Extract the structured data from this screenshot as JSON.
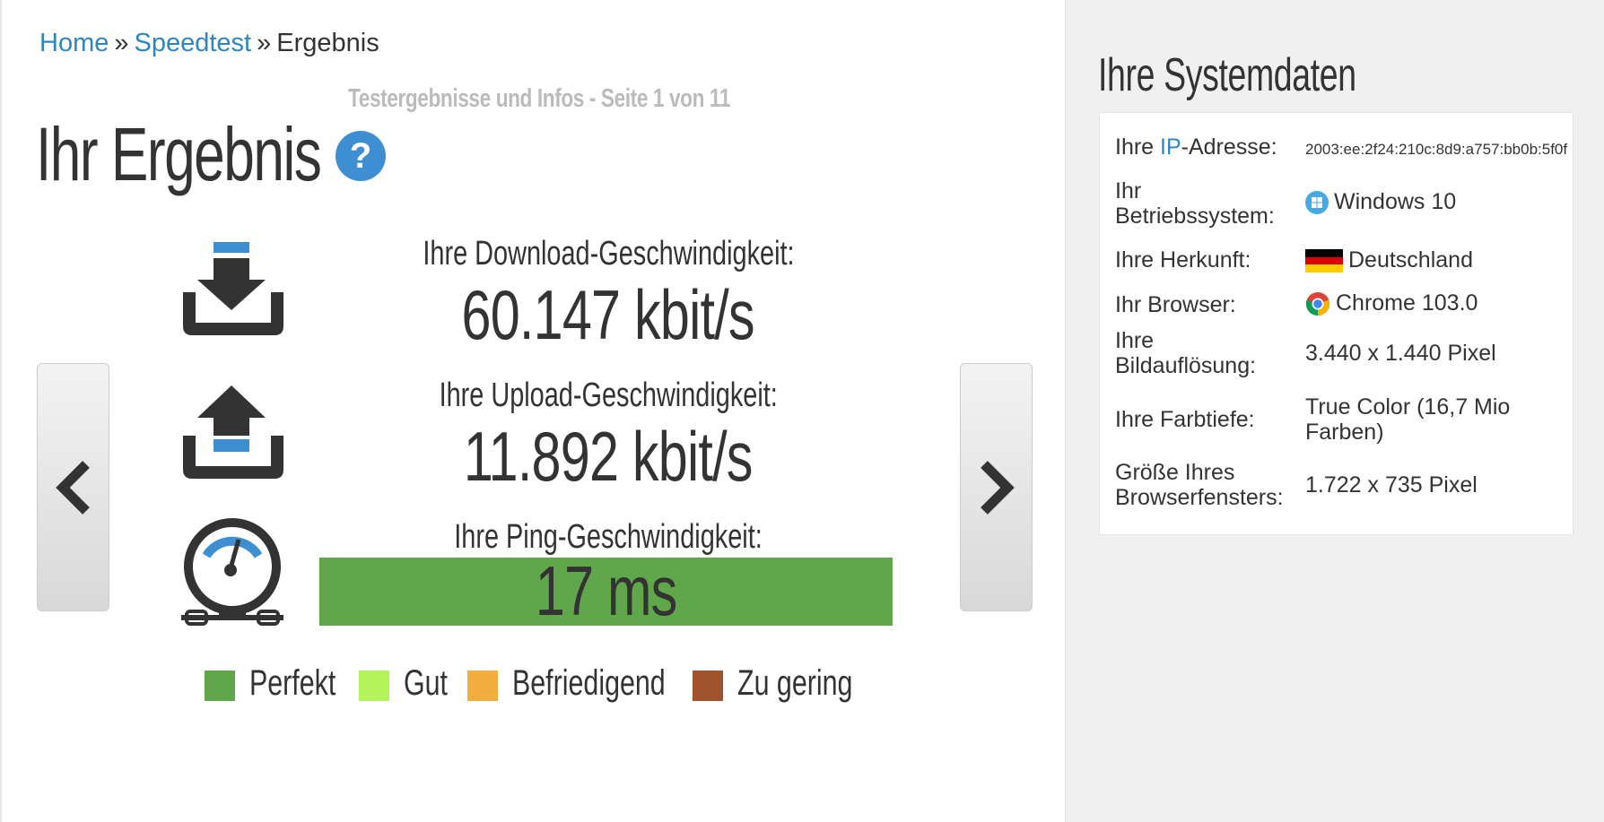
{
  "breadcrumb": {
    "home": "Home",
    "separator": "»",
    "speedtest": "Speedtest",
    "current": "Ergebnis"
  },
  "subtitle": "Testergebnisse und Infos - Seite 1 von 11",
  "heading": "Ihr Ergebnis",
  "help_badge": "?",
  "download": {
    "label": "Ihre Download-Geschwindigkeit:",
    "value": "60.147 kbit/s"
  },
  "upload": {
    "label": "Ihre Upload-Geschwindigkeit:",
    "value": "11.892 kbit/s"
  },
  "ping": {
    "label": "Ihre Ping-Geschwindigkeit:",
    "value": "17 ms",
    "rating_color": "#60a64a"
  },
  "legend": [
    {
      "label": "Perfekt",
      "color": "#60a64a"
    },
    {
      "label": "Gut",
      "color": "#b3f25b"
    },
    {
      "label": "Befriedigend",
      "color": "#f2ae3d"
    },
    {
      "label": "Zu gering",
      "color": "#a0522d"
    }
  ],
  "nav": {
    "prev_icon": "chevron-left-icon",
    "next_icon": "chevron-right-icon"
  },
  "system": {
    "title": "Ihre Systemdaten",
    "ip": {
      "key_prefix": "Ihre ",
      "key_link": "IP",
      "key_suffix": "-Adresse:",
      "value": "2003:ee:2f24:210c:8d9:a757:bb0b:5f0f"
    },
    "os": {
      "key": "Ihr Betriebssystem:",
      "value": "Windows 10",
      "icon": "windows-icon"
    },
    "origin": {
      "key": "Ihre Herkunft:",
      "value": "Deutschland",
      "icon": "germany-flag-icon"
    },
    "browser": {
      "key": "Ihr Browser:",
      "value": "Chrome 103.0",
      "icon": "chrome-icon"
    },
    "resolution": {
      "key": "Ihre Bildauflösung:",
      "value": "3.440 x 1.440 Pixel"
    },
    "color_depth": {
      "key": "Ihre Farbtiefe:",
      "value": "True Color (16,7 Mio Farben)"
    },
    "window_size": {
      "key": "Größe Ihres Browserfensters:",
      "value": "1.722 x 735 Pixel"
    }
  },
  "colors": {
    "link": "#2e86c1",
    "accent_blue": "#3d8fd1",
    "icon_dark": "#333333",
    "sidebar_bg": "#f0f0f0"
  }
}
